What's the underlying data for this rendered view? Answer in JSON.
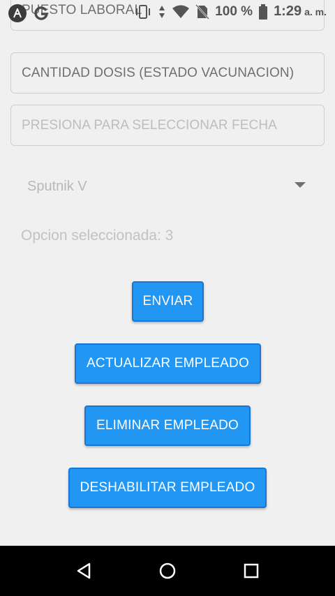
{
  "status_bar": {
    "battery_percent": "100 %",
    "time": "1:29",
    "ampm": "a. m."
  },
  "form": {
    "puesto_placeholder": "PUESTO LABORAL",
    "cantidad_placeholder": "CANTIDAD DOSIS (ESTADO VACUNACION)",
    "fecha_placeholder": "PRESIONA PARA SELECCIONAR FECHA",
    "vaccine_selected": "Sputnik V",
    "selected_option_text": "Opcion seleccionada: 3"
  },
  "buttons": {
    "enviar": "ENVIAR",
    "actualizar": "ACTUALIZAR EMPLEADO",
    "eliminar": "ELIMINAR EMPLEADO",
    "deshabilitar": "DESHABILITAR EMPLEADO"
  },
  "colors": {
    "accent": "#2196f3",
    "background": "#f0f0f0"
  }
}
